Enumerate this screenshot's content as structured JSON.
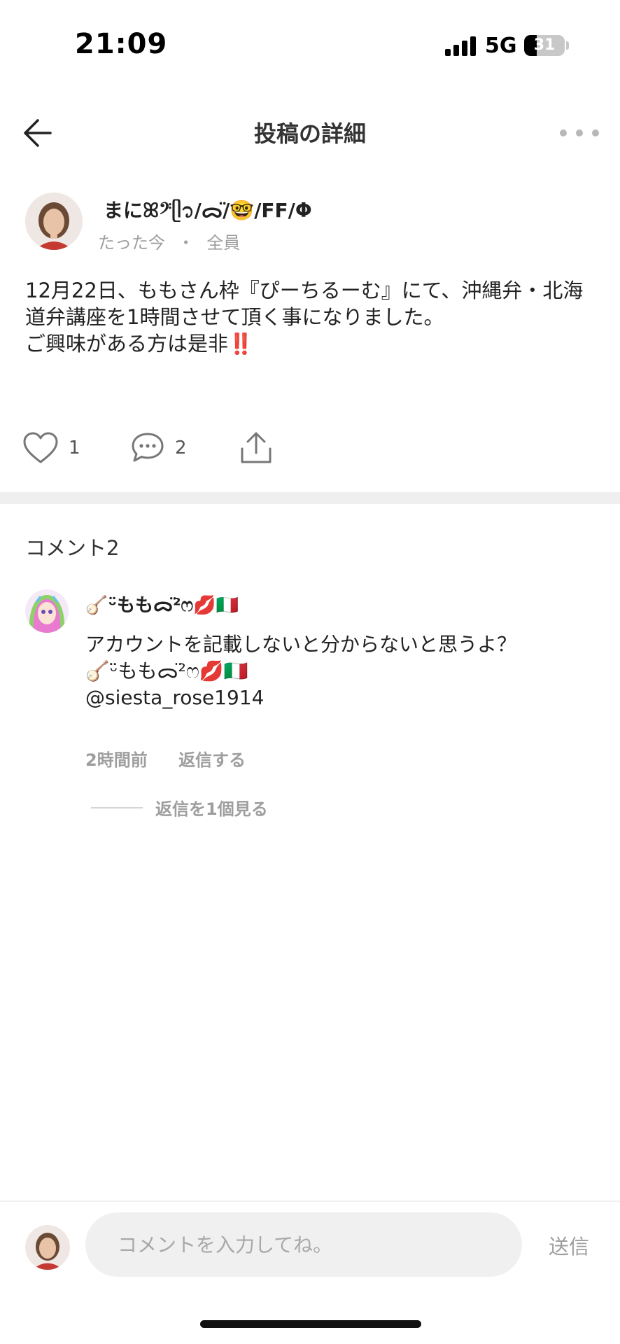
{
  "status_bar": {
    "time": "21:09",
    "network": "5G",
    "battery": "31",
    "battery_level_percent": 31
  },
  "nav": {
    "title": "投稿の詳細",
    "back_icon": "arrow-left-icon",
    "more_icon": "more-horizontal-icon"
  },
  "post": {
    "author": "まにꕤ𝄢ᥫ᭡/ᯅ̈/🤓/FF/Φ",
    "time": "たった今",
    "separator": "・",
    "audience": "全員",
    "body_lines": [
      "12月22日、ももさん枠『ぴーちるーむ』にて、沖縄弁・北海",
      "道弁講座を1時間させて頂く事になりました。",
      "ご興味がある方は是非‼️"
    ],
    "likes": "1",
    "comments": "2"
  },
  "comments_section": {
    "heading": "コメント2",
    "items": [
      {
        "author": "🪕ᵕ̈ももᯅ̈²ෆ💋🇮🇹",
        "text_lines": [
          "アカウントを記載しないと分からないと思うよ？",
          "🪕ᵕ̈ももᯅ̈²ෆ💋🇮🇹",
          "@siesta_rose1914"
        ],
        "time": "2時間前",
        "reply_label": "返信する",
        "view_replies": "返信を1個見る"
      }
    ]
  },
  "input_bar": {
    "placeholder": "コメントを入力してね。",
    "send_label": "送信"
  },
  "colors": {
    "muted_text": "#9e9e9e",
    "band": "#efefef",
    "input_bg": "#f0f0f0"
  }
}
